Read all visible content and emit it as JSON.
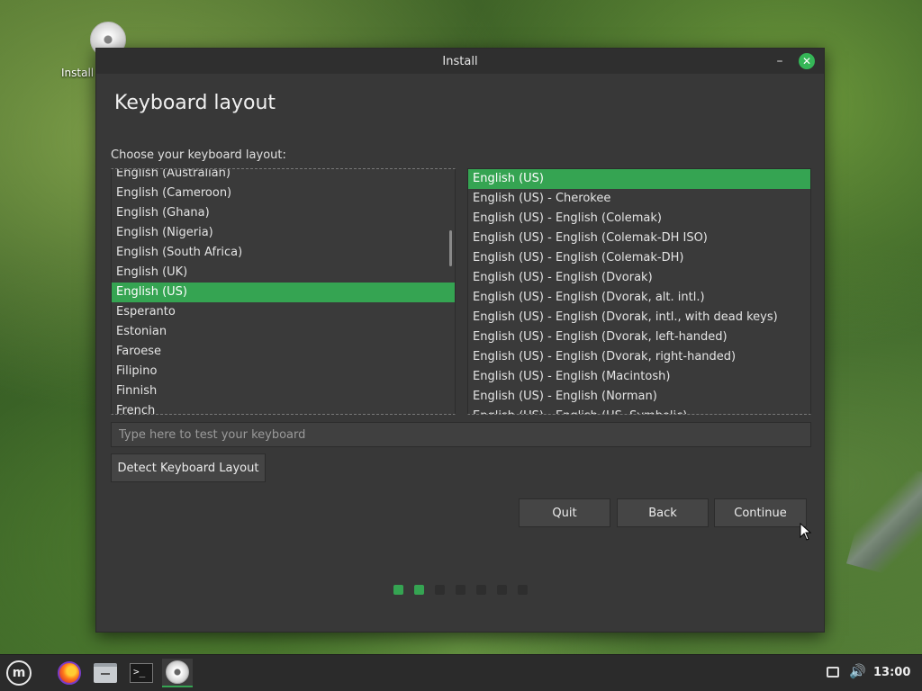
{
  "desktop": {
    "icon_label": "Install"
  },
  "window": {
    "title": "Install",
    "minimize_glyph": "–",
    "close_glyph": "✕"
  },
  "page": {
    "heading": "Keyboard layout",
    "prompt": "Choose your keyboard layout:"
  },
  "layouts": {
    "selected": "English (US)",
    "items": [
      "English (Australian)",
      "English (Cameroon)",
      "English (Ghana)",
      "English (Nigeria)",
      "English (South Africa)",
      "English (UK)",
      "English (US)",
      "Esperanto",
      "Estonian",
      "Faroese",
      "Filipino",
      "Finnish",
      "French"
    ]
  },
  "variants": {
    "selected": "English (US)",
    "items": [
      "English (US)",
      "English (US) - Cherokee",
      "English (US) - English (Colemak)",
      "English (US) - English (Colemak-DH ISO)",
      "English (US) - English (Colemak-DH)",
      "English (US) - English (Dvorak)",
      "English (US) - English (Dvorak, alt. intl.)",
      "English (US) - English (Dvorak, intl., with dead keys)",
      "English (US) - English (Dvorak, left-handed)",
      "English (US) - English (Dvorak, right-handed)",
      "English (US) - English (Macintosh)",
      "English (US) - English (Norman)",
      "English (US) - English (US, Symbolic)"
    ]
  },
  "test_input": {
    "placeholder": "Type here to test your keyboard",
    "value": ""
  },
  "buttons": {
    "detect": "Detect Keyboard Layout",
    "quit": "Quit",
    "back": "Back",
    "continue": "Continue"
  },
  "progress": {
    "total_steps": 7,
    "completed_steps": 2
  },
  "taskbar": {
    "clock": "13:00",
    "menu_glyph": "m",
    "terminal_glyph": ">_",
    "volume_glyph": "🔊"
  },
  "colors": {
    "accent": "#35a452",
    "window_bg": "#383838",
    "titlebar_bg": "#2f2f2f",
    "taskbar_bg": "#2b2b2b"
  }
}
